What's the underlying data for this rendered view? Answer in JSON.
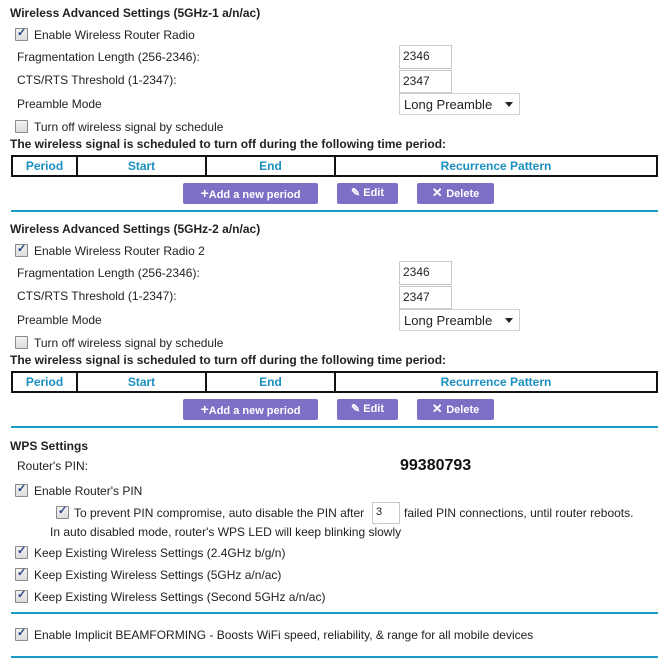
{
  "sections": [
    {
      "title": "Wireless Advanced Settings (5GHz-1 a/n/ac)",
      "enable_label": "Enable Wireless Router Radio",
      "enable_checked": true,
      "frag_label": "Fragmentation Length (256-2346):",
      "frag_value": "2346",
      "cts_label": "CTS/RTS Threshold (1-2347):",
      "cts_value": "2347",
      "preamble_label": "Preamble Mode",
      "preamble_value": "Long Preamble",
      "schedule_label": "Turn off wireless signal by schedule",
      "schedule_checked": false,
      "schedule_heading": "The wireless signal is scheduled to turn off during the following time period:",
      "columns": [
        "Period",
        "Start",
        "End",
        "Recurrence Pattern"
      ],
      "add_label": "Add a new period",
      "edit_label": "Edit",
      "delete_label": "Delete"
    },
    {
      "title": "Wireless Advanced Settings (5GHz-2 a/n/ac)",
      "enable_label": "Enable Wireless Router Radio 2",
      "enable_checked": true,
      "frag_label": "Fragmentation Length (256-2346):",
      "frag_value": "2346",
      "cts_label": "CTS/RTS Threshold (1-2347):",
      "cts_value": "2347",
      "preamble_label": "Preamble Mode",
      "preamble_value": "Long Preamble",
      "schedule_label": "Turn off wireless signal by schedule",
      "schedule_checked": false,
      "schedule_heading": "The wireless signal is scheduled to turn off during the following time period:",
      "columns": [
        "Period",
        "Start",
        "End",
        "Recurrence Pattern"
      ],
      "add_label": "Add a new period",
      "edit_label": "Edit",
      "delete_label": "Delete"
    }
  ],
  "wps": {
    "title": "WPS Settings",
    "pin_label": "Router's PIN:",
    "pin_value": "99380793",
    "enable_pin_label": "Enable Router's PIN",
    "prevent_before": "To prevent PIN compromise, auto disable the PIN after",
    "prevent_value": "3",
    "prevent_after": "failed PIN connections, until router reboots.",
    "auto_note": "In auto disabled mode, router's WPS LED will keep blinking slowly",
    "keep": [
      "Keep Existing Wireless Settings (2.4GHz b/g/n)",
      "Keep Existing Wireless Settings (5GHz a/n/ac)",
      "Keep Existing Wireless Settings (Second 5GHz a/n/ac)"
    ]
  },
  "beamforming_label": "Enable Implicit BEAMFORMING - Boosts WiFi speed, reliability, & range for all mobile devices",
  "colors": {
    "accent": "#1a9bc4",
    "button": "#7b6fc6"
  }
}
